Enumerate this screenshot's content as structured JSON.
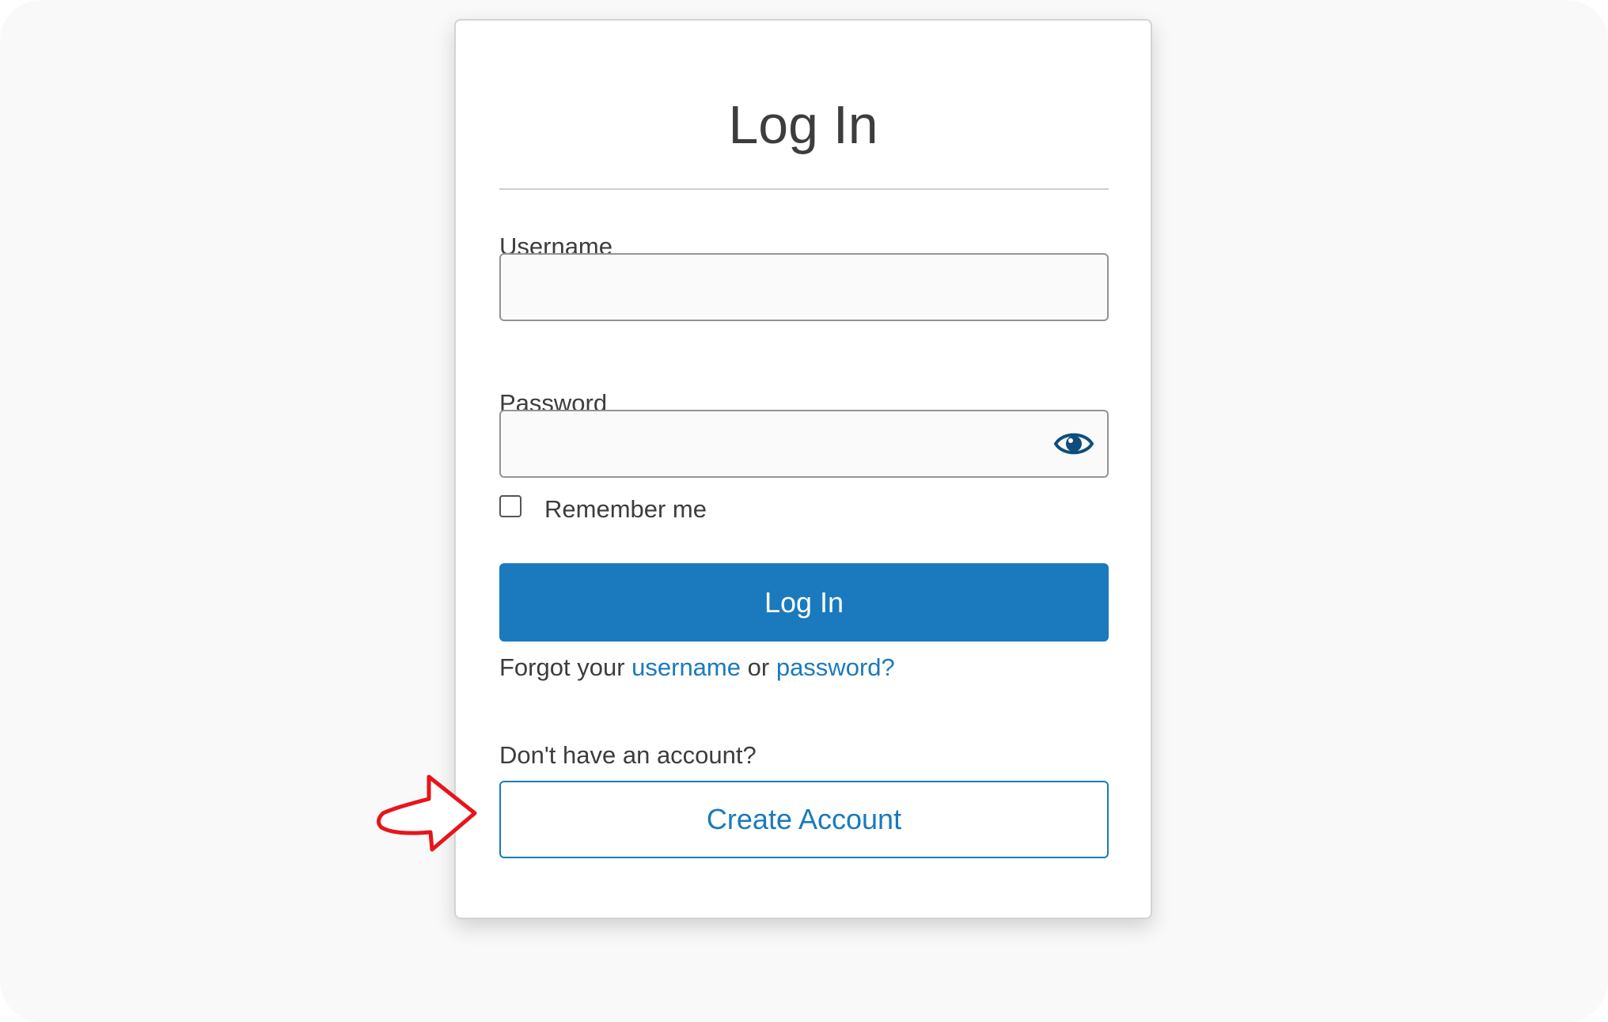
{
  "form": {
    "title": "Log In",
    "username_label": "Username",
    "username_value": "",
    "password_label": "Password",
    "password_value": "",
    "show_password_icon": "eye-icon",
    "remember_label": "Remember me",
    "remember_checked": false,
    "login_button": "Log In",
    "forgot_prefix": "Forgot your",
    "forgot_username_link": "username",
    "forgot_or": "or",
    "forgot_password_link": "password?",
    "no_account_text": "Don't have an account?",
    "create_account_button": "Create Account"
  },
  "annotation": {
    "icon": "arrow-pointer-icon",
    "color": "#e8141c"
  },
  "colors": {
    "accent": "#1a7abd",
    "text": "#3d3d3d",
    "eye_icon": "#0e4d7d"
  }
}
